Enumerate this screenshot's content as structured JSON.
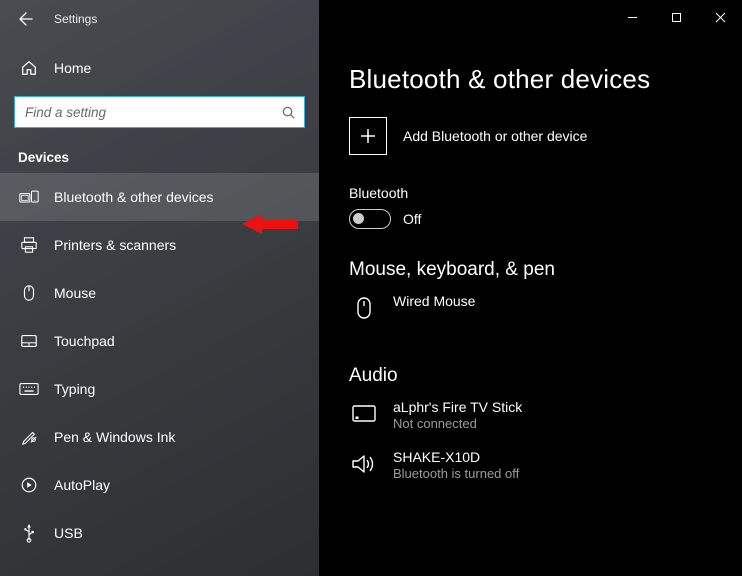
{
  "titlebar": {
    "title": "Settings"
  },
  "sidebar": {
    "home": "Home",
    "search_placeholder": "Find a setting",
    "section_label": "Devices",
    "items": [
      {
        "label": "Bluetooth & other devices"
      },
      {
        "label": "Printers & scanners"
      },
      {
        "label": "Mouse"
      },
      {
        "label": "Touchpad"
      },
      {
        "label": "Typing"
      },
      {
        "label": "Pen & Windows Ink"
      },
      {
        "label": "AutoPlay"
      },
      {
        "label": "USB"
      }
    ]
  },
  "main": {
    "title": "Bluetooth & other devices",
    "add_label": "Add Bluetooth or other device",
    "bluetooth_label": "Bluetooth",
    "toggle_state": "Off",
    "groups": [
      {
        "title": "Mouse, keyboard, & pen",
        "devices": [
          {
            "name": "Wired Mouse",
            "sub": ""
          }
        ]
      },
      {
        "title": "Audio",
        "devices": [
          {
            "name": "aLphr's Fire TV Stick",
            "sub": "Not connected"
          },
          {
            "name": "SHAKE-X10D",
            "sub": "Bluetooth is turned off"
          }
        ]
      }
    ]
  }
}
